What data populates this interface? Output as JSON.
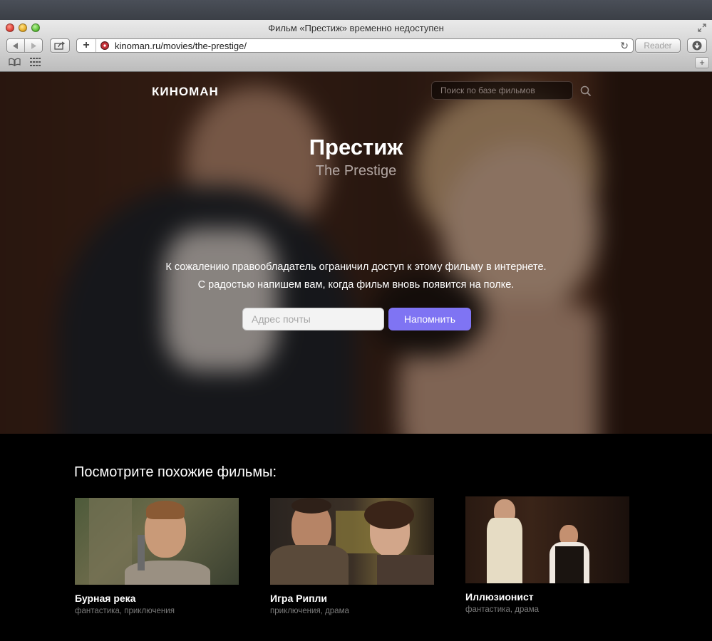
{
  "browser": {
    "window_title": "Фильм «Престиж» временно недоступен",
    "url": "kinoman.ru/movies/the-prestige/",
    "reader_label": "Reader"
  },
  "site": {
    "brand": "КИНОМАН",
    "search_placeholder": "Поиск по базе фильмов"
  },
  "movie": {
    "title_ru": "Престиж",
    "title_en": "The Prestige",
    "message_line1": "К сожалению правообладатель ограничил доступ к этому фильму в интернете.",
    "message_line2": "С радостью напишем вам, когда фильм вновь появится на полке.",
    "email_placeholder": "Адрес почты",
    "remind_button": "Напомнить"
  },
  "similar": {
    "heading": "Посмотрите похожие фильмы:",
    "items": [
      {
        "title": "Бурная река",
        "genres": "фантастика, приключения"
      },
      {
        "title": "Игра Рипли",
        "genres": "приключения, драма"
      },
      {
        "title": "Иллюзионист",
        "genres": "фантастика, драма"
      }
    ]
  },
  "colors": {
    "accent_button": "#7f74f3",
    "page_background": "#000000",
    "muted_text": "#7a7a7a"
  }
}
